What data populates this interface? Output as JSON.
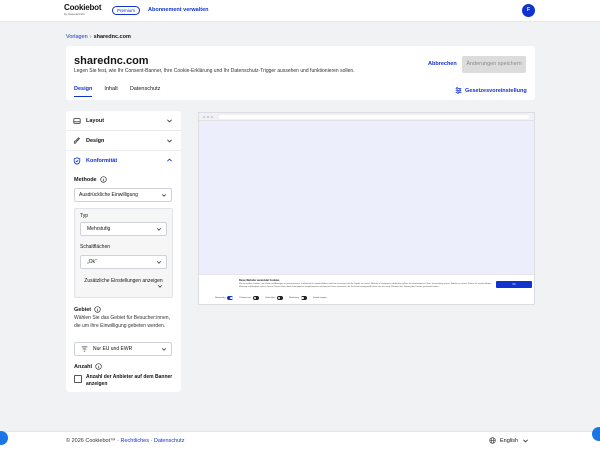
{
  "topbar": {
    "logo_main": "Cookiebot",
    "logo_sub": "by Usercentrics",
    "premium_badge": "Premium",
    "manage_subscription": "Abonnement verwalten",
    "avatar_initial": "F"
  },
  "breadcrumb": {
    "parent": "Vorlagen",
    "separator": "›",
    "current": "sharednc.com"
  },
  "header": {
    "title": "sharednc.com",
    "description": "Legen Sie fest, wie Ihr Consent-Banner, Ihre Cookie-Erklärung und Ihr Datenschutz-Trigger aussehen und funktionieren sollen.",
    "cancel_label": "Abbrechen",
    "save_label": "Änderungen speichern",
    "law_setting_label": "Gesetzesvoreinstellung",
    "tabs": [
      {
        "label": "Design",
        "active": true
      },
      {
        "label": "Inhalt",
        "active": false
      },
      {
        "label": "Datenschutz",
        "active": false
      }
    ]
  },
  "sidebar": {
    "sections": [
      {
        "label": "Layout",
        "icon": "layout-icon",
        "open": false
      },
      {
        "label": "Design",
        "icon": "brush-icon",
        "open": false
      },
      {
        "label": "Konformität",
        "icon": "shield-icon",
        "open": true
      }
    ],
    "method": {
      "label": "Methode",
      "value": "Ausdrückliche Einwilligung"
    },
    "type": {
      "label": "Typ",
      "value": "Mehrstufig"
    },
    "buttons": {
      "label": "Schaltflächen",
      "value": "„Ok“",
      "more_settings": "Zusätzliche Einstellungen anzeigen"
    },
    "area": {
      "label": "Gebiet",
      "description": "Wählen Sie das Gebiet für Besucher:innen, die um ihre Einwilligung gebeten werden.",
      "value": "Nur EU und EWR"
    },
    "display": {
      "label": "Anzahl",
      "checkbox_label": "Anzahl der Anbieter auf dem Banner anzeigen",
      "checked": false
    }
  },
  "preview": {
    "banner_title": "Diese Website verwendet Cookies",
    "banner_text": "Wir verwenden Cookies, um Inhalte und Anzeigen zu personalisieren, Funktionen für soziale Medien anbieten zu können und die Zugriffe auf unsere Website zu analysieren. Außerdem geben wir Informationen zu Ihrer Verwendung unserer Website an unsere Partner für soziale Medien, Werbung und Analysen weiter. Unsere Partner führen diese Informationen möglicherweise mit weiteren Daten zusammen, die Sie ihnen bereitgestellt haben oder die sie im Rahmen Ihrer Nutzung der Dienste gesammelt haben.",
    "ok_label": "Ok",
    "toggles": [
      {
        "label": "Notwendig",
        "on": true
      },
      {
        "label": "Präferenzen",
        "on": false
      },
      {
        "label": "Statistiken",
        "on": false
      },
      {
        "label": "Marketing",
        "on": false
      }
    ],
    "details_label": "Details zeigen"
  },
  "footer": {
    "copyright": "© 2026 Cookiebot™",
    "separator": "·",
    "legal": "Rechtliches",
    "privacy": "Datenschutz",
    "language": "English"
  },
  "colors": {
    "accent": "#1032cf",
    "background": "#f1f2f4"
  }
}
